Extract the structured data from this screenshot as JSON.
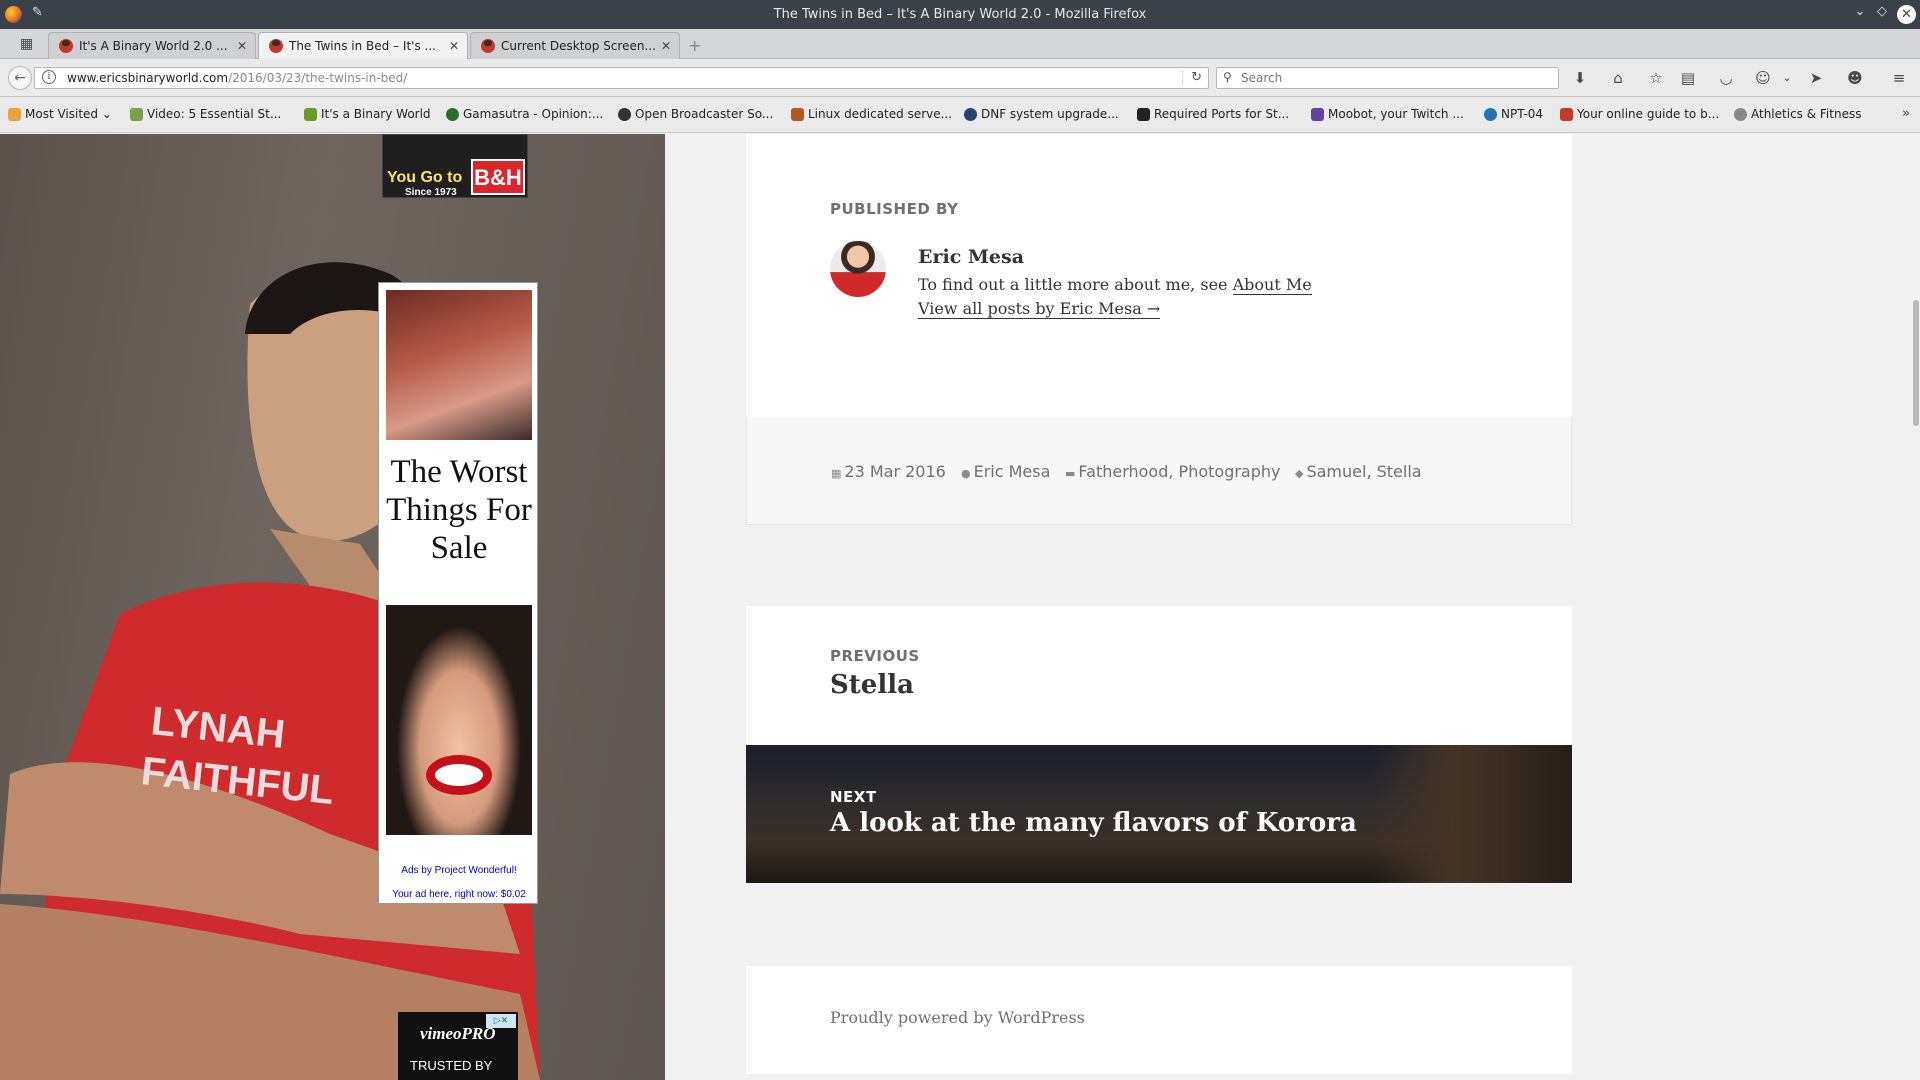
{
  "window": {
    "title": "The Twins in Bed – It's A Binary World 2.0 - Mozilla Firefox"
  },
  "tabs": [
    {
      "label": "It's A Binary World 2.0 ...",
      "active": false
    },
    {
      "label": "The Twins in Bed – It's ...",
      "active": true
    },
    {
      "label": "Current Desktop Screen...",
      "active": false
    }
  ],
  "navbar": {
    "url_host": "www.ericsbinaryworld.com",
    "url_path": "/2016/03/23/the-twins-in-bed/",
    "search_placeholder": "Search"
  },
  "bookmarks": [
    {
      "label": "Most Visited",
      "icon": "most-visited-icon",
      "color": "#e8a33d"
    },
    {
      "label": "Video: 5 Essential St...",
      "icon": "x-icon",
      "color": "#7aa04a"
    },
    {
      "label": "It's a Binary World",
      "icon": "leaf-icon",
      "color": "#6c9a2a"
    },
    {
      "label": "Gamasutra - Opinion:...",
      "icon": "gamasutra-icon",
      "color": "#2e6b2e"
    },
    {
      "label": "Open Broadcaster So...",
      "icon": "obs-icon",
      "color": "#333333"
    },
    {
      "label": "Linux dedicated serve...",
      "icon": "server-icon",
      "color": "#b35a1f"
    },
    {
      "label": "DNF system upgrade...",
      "icon": "fedora-icon",
      "color": "#294172"
    },
    {
      "label": "Required Ports for St...",
      "icon": "steam-icon",
      "color": "#222222"
    },
    {
      "label": "Moobot, your Twitch ...",
      "icon": "twitch-icon",
      "color": "#6441a5"
    },
    {
      "label": "NPT-04",
      "icon": "npt-icon",
      "color": "#2a6fb0"
    },
    {
      "label": "Your online guide to b...",
      "icon": "flag-icon",
      "color": "#c0392b"
    },
    {
      "label": "Athletics & Fitness",
      "icon": "globe-icon",
      "color": "#888888"
    }
  ],
  "ads": {
    "top_ad_text": "You Go to",
    "top_ad_sub": "Since 1973",
    "top_ad_brand": "B&H",
    "side_ad_headline": "The Worst Things For Sale",
    "side_ad_by": "Ads by Project Wonderful!",
    "side_ad_here": "Your ad here, right now: $0.02",
    "vimeo_logo": "vimeoPRO",
    "vimeo_text": "TRUSTED BY"
  },
  "author_box": {
    "heading": "PUBLISHED BY",
    "name": "Eric Mesa",
    "bio_prefix": "To find out a little more about me, see",
    "bio_link": "About Me",
    "posts_link": "View all posts by Eric Mesa →"
  },
  "entry_meta": {
    "date": "23 Mar 2016",
    "author": "Eric Mesa",
    "categories": "Fatherhood, Photography",
    "tags": "Samuel, Stella"
  },
  "post_nav": {
    "previous_label": "PREVIOUS",
    "previous_title": "Stella",
    "next_label": "NEXT",
    "next_title": "A look at the many flavors of Korora"
  },
  "footer": {
    "powered": "Proudly powered by WordPress"
  }
}
